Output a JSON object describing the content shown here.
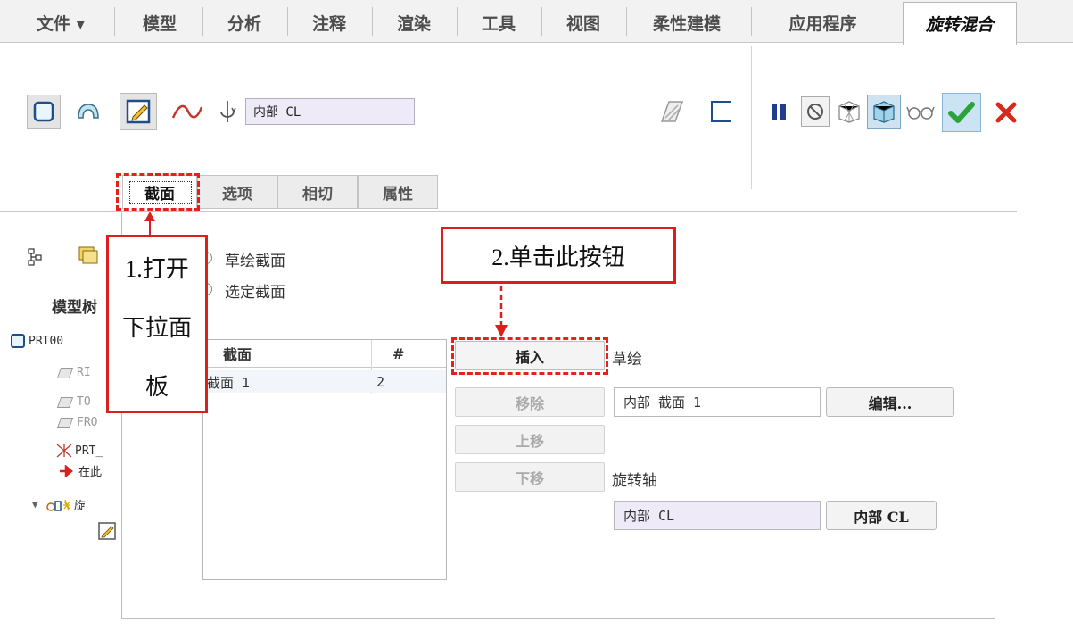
{
  "menu": {
    "file": "文件 ▾",
    "model": "模型",
    "analysis": "分析",
    "annotate": "注释",
    "render": "渲染",
    "tools": "工具",
    "view": "视图",
    "flexible_modeling": "柔性建模",
    "applications": "应用程序",
    "active_tab": "旋转混合"
  },
  "ribbon": {
    "axis_field_label": "内部 CL"
  },
  "sub_tabs": {
    "sections": "截面",
    "options": "选项",
    "tangency": "相切",
    "properties": "属性"
  },
  "left_panel": {
    "header": "模型树",
    "items": [
      "PRT00",
      "RI",
      "TO",
      "FRO",
      "PRT_",
      "在此",
      "旋"
    ]
  },
  "panel": {
    "radio_sketched": "草绘截面",
    "radio_selected": "选定截面",
    "table_header_section": "截面",
    "table_header_num": "#",
    "row1_section": "截面 1",
    "row1_num": "2",
    "insert": "插入",
    "remove": "移除",
    "move_up": "上移",
    "move_down": "下移",
    "sketch_label": "草绘",
    "sketch_value": "内部 截面 1",
    "edit_button": "编辑...",
    "axis_label": "旋转轴",
    "axis_value": "内部 CL",
    "axis_button": "内部 CL"
  },
  "annotations": {
    "step1": [
      "1.打开",
      "下拉面",
      "板"
    ],
    "step2": "2.单击此按钮"
  },
  "colors": {
    "annotation_red": "#d9201c",
    "checkmark_green": "#2ca33a",
    "axis_field_bg": "#eeeaf7"
  }
}
